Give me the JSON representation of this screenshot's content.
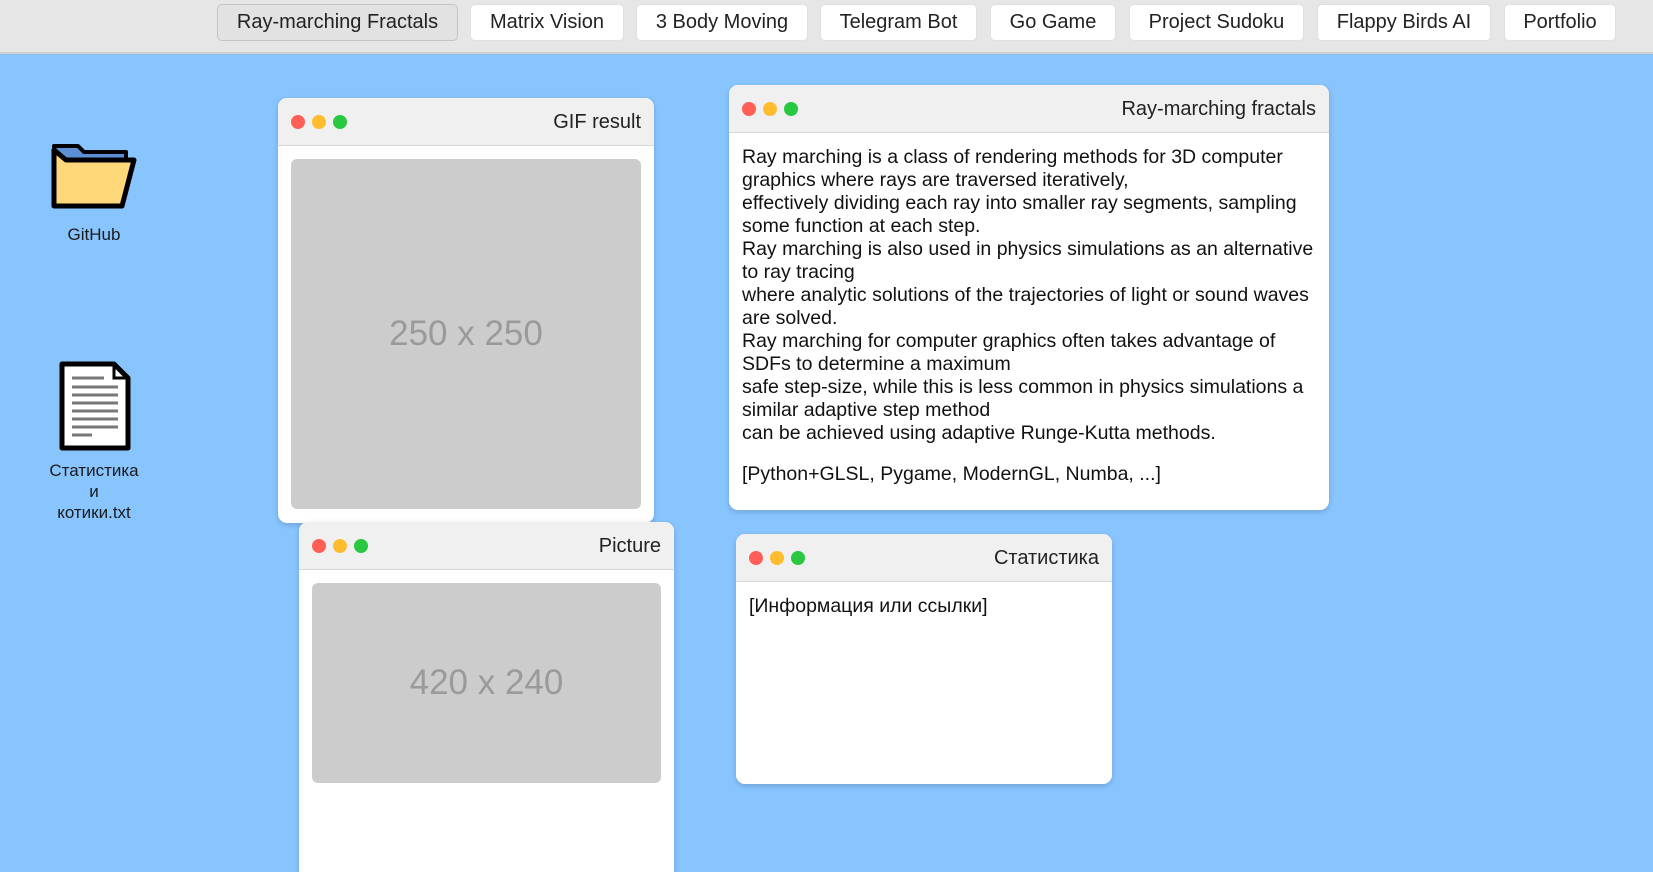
{
  "nav": {
    "items": [
      {
        "label": "Ray-marching Fractals",
        "active": true
      },
      {
        "label": "Matrix Vision",
        "active": false
      },
      {
        "label": "3 Body Moving",
        "active": false
      },
      {
        "label": "Telegram Bot",
        "active": false
      },
      {
        "label": "Go Game",
        "active": false
      },
      {
        "label": "Project Sudoku",
        "active": false
      },
      {
        "label": "Flappy Birds AI",
        "active": false
      },
      {
        "label": "Portfolio",
        "active": false
      }
    ]
  },
  "desktop": {
    "github": {
      "label": "GitHub",
      "icon": "folder-icon"
    },
    "stats_file": {
      "label_line1": "Статистика",
      "label_line2": "и",
      "label_line3": "котики.txt",
      "icon": "text-file-icon"
    }
  },
  "windows": {
    "gif": {
      "title": "GIF result",
      "placeholder": "250 x 250"
    },
    "picture": {
      "title": "Picture",
      "placeholder": "420 x 240"
    },
    "ray": {
      "title": "Ray-marching fractals",
      "lines": [
        "Ray marching is a class of rendering methods for 3D computer graphics where rays are traversed iteratively,",
        "effectively dividing each ray into smaller ray segments, sampling some function at each step.",
        "Ray marching is also used in physics simulations as an alternative to ray tracing",
        "where analytic solutions of the trajectories of light or sound waves are solved.",
        "Ray marching for computer graphics often takes advantage of SDFs to determine a maximum",
        "safe step-size, while this is less common in physics simulations a similar adaptive step method",
        "can be achieved using adaptive Runge-Kutta methods."
      ],
      "tech": "[Python+GLSL, Pygame, ModernGL, Numba, ...]"
    },
    "stats": {
      "title": "Статистика",
      "text": "[Информация или ссылки]"
    }
  },
  "colors": {
    "desktop_bg": "#88c5ff",
    "close": "#ff5f57",
    "minimize": "#febc2e",
    "maximize": "#28c840",
    "placeholder_bg": "#cccccc"
  }
}
